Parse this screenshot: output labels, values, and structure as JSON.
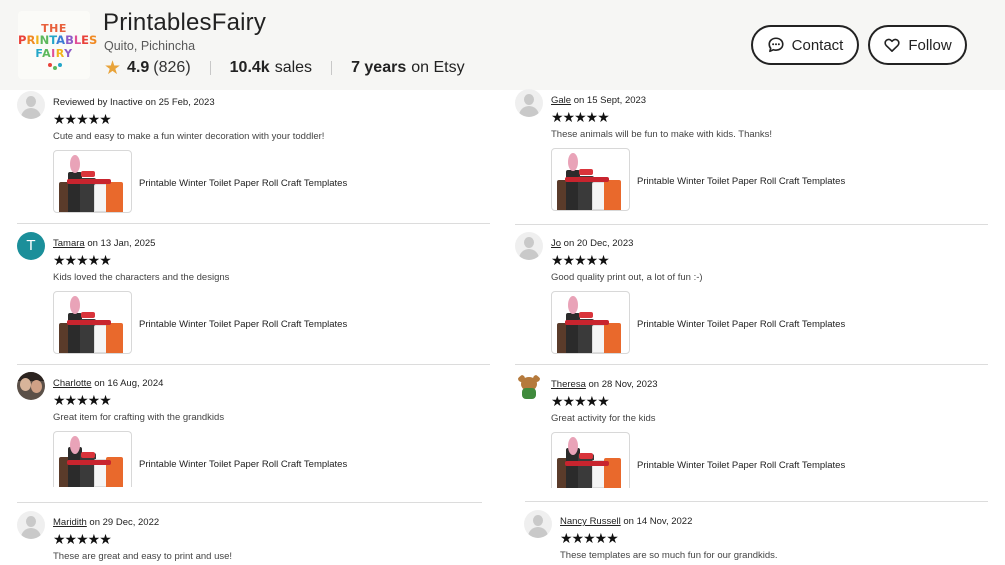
{
  "shop": {
    "logo_line1": "THE",
    "logo_line2": "PRINTABLES",
    "logo_line3": "FAIRY",
    "name": "PrintablesFairy",
    "location": "Quito, Pichincha",
    "rating": "4.9",
    "rating_count": "(826)",
    "sales_value": "10.4k",
    "sales_label": "sales",
    "years_value": "7 years",
    "years_label": "on Etsy"
  },
  "buttons": {
    "contact": "Contact",
    "follow": "Follow"
  },
  "colors": {
    "header_bg": "#f6f6f4",
    "star_accent": "#e8a33a",
    "avatar_teal": "#1b8f9a"
  },
  "reviews": [
    {
      "user": "Reviewed by Inactive",
      "date": " on 25 Feb, 2023",
      "stars": "★★★★★",
      "text": "Cute and easy to make a fun winter decoration with your toddler!",
      "item": "Printable Winter Toilet Paper Roll Craft Templates",
      "avatar": "default-avatar-icon"
    },
    {
      "user": "Gale",
      "date": " on 15 Sept, 2023",
      "stars": "★★★★★",
      "text": "These animals will be fun to make with kids. Thanks!",
      "item": "Printable Winter Toilet Paper Roll Craft Templates",
      "avatar": "default-avatar-icon"
    },
    {
      "user": "Tamara",
      "date": " on 13 Jan, 2025",
      "stars": "★★★★★",
      "text": "Kids loved the characters and the designs",
      "item": "Printable Winter Toilet Paper Roll Craft Templates",
      "avatar": "initial-avatar",
      "initial": "T"
    },
    {
      "user": "Jo",
      "date": " on 20 Dec, 2023",
      "stars": "★★★★★",
      "text": "Good quality print out, a lot of fun :-)",
      "item": "Printable Winter Toilet Paper Roll Craft Templates",
      "avatar": "default-avatar-icon"
    },
    {
      "user": "Charlotte",
      "date": " on 16 Aug, 2024",
      "stars": "★★★★★",
      "text": "Great item for crafting with the grandkids",
      "item": "Printable Winter Toilet Paper Roll Craft Templates",
      "avatar": "photo-avatar"
    },
    {
      "user": "Theresa",
      "date": " on 28 Nov, 2023",
      "stars": "★★★★★",
      "text": "Great activity for the kids",
      "item": "Printable Winter Toilet Paper Roll Craft Templates",
      "avatar": "teddy-bear-avatar"
    },
    {
      "user": "Maridith",
      "date": " on 29 Dec, 2022",
      "stars": "★★★★★",
      "text": "These are great and easy to print and use!",
      "item": "",
      "avatar": "default-avatar-icon"
    },
    {
      "user": "Nancy Russell",
      "date": " on 14 Nov, 2022",
      "stars": "★★★★★",
      "text": "These templates are so much fun for our grandkids.",
      "item": "",
      "avatar": "default-avatar-icon"
    }
  ]
}
